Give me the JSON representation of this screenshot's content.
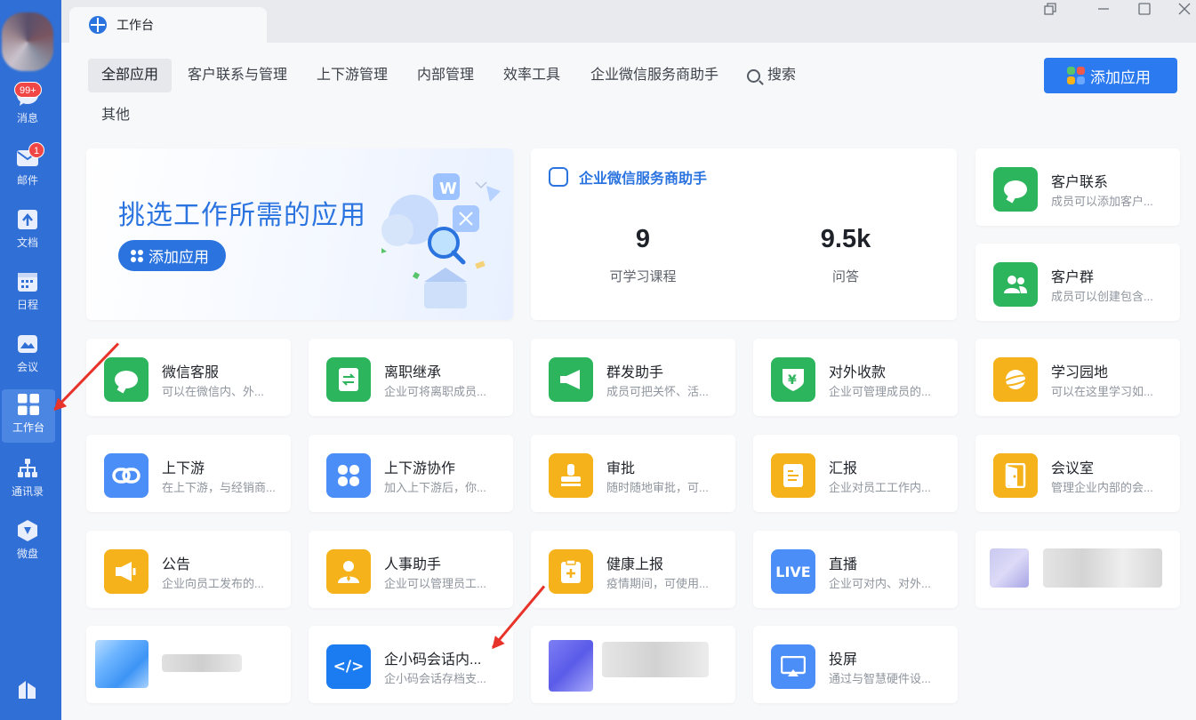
{
  "sidebar": {
    "items": [
      {
        "label": "消息",
        "badge": "99+"
      },
      {
        "label": "邮件",
        "badge": "1"
      },
      {
        "label": "文档"
      },
      {
        "label": "日程"
      },
      {
        "label": "会议"
      },
      {
        "label": "工作台"
      },
      {
        "label": "通讯录"
      },
      {
        "label": "微盘"
      }
    ]
  },
  "window": {
    "tab_title": "工作台"
  },
  "filters": [
    "全部应用",
    "客户联系与管理",
    "上下游管理",
    "内部管理",
    "效率工具",
    "企业微信服务商助手",
    "搜索",
    "其他"
  ],
  "add_app_button": "添加应用",
  "banner": {
    "title": "挑选工作所需的应用",
    "button": "添加应用"
  },
  "helper": {
    "title": "企业微信服务商助手",
    "stats": [
      {
        "value": "9",
        "label": "可学习课程"
      },
      {
        "value": "9.5k",
        "label": "问答"
      }
    ]
  },
  "apps": [
    {
      "title": "客户联系",
      "desc": "成员可以添加客户...",
      "color": "#2db55d",
      "icon": "wechat-bubble-icon"
    },
    {
      "title": "客户群",
      "desc": "成员可以创建包含...",
      "color": "#2db55d",
      "icon": "group-icon"
    },
    {
      "title": "微信客服",
      "desc": "可以在微信内、外...",
      "color": "#2db55d",
      "icon": "chat-bubble-icon"
    },
    {
      "title": "离职继承",
      "desc": "企业可将离职成员...",
      "color": "#2db55d",
      "icon": "transfer-doc-icon"
    },
    {
      "title": "群发助手",
      "desc": "成员可把关怀、活...",
      "color": "#2db55d",
      "icon": "megaphone-icon"
    },
    {
      "title": "对外收款",
      "desc": "企业可管理成员的...",
      "color": "#2db55d",
      "icon": "yuan-shield-icon"
    },
    {
      "title": "学习园地",
      "desc": "可以在这里学习如...",
      "color": "#f5b21b",
      "icon": "planet-icon"
    },
    {
      "title": "上下游",
      "desc": "在上下游，与经销商...",
      "color": "#4c8ef7",
      "icon": "link-icon"
    },
    {
      "title": "上下游协作",
      "desc": "加入上下游后，你...",
      "color": "#4c8ef7",
      "icon": "clover-icon"
    },
    {
      "title": "审批",
      "desc": "随时随地审批，可...",
      "color": "#f5b21b",
      "icon": "stamp-icon"
    },
    {
      "title": "汇报",
      "desc": "企业对员工工作内...",
      "color": "#f5b21b",
      "icon": "report-icon"
    },
    {
      "title": "会议室",
      "desc": "管理企业内部的会...",
      "color": "#f5b21b",
      "icon": "door-icon"
    },
    {
      "title": "公告",
      "desc": "企业向员工发布的...",
      "color": "#f5b21b",
      "icon": "announce-icon"
    },
    {
      "title": "人事助手",
      "desc": "企业可以管理员工...",
      "color": "#f5b21b",
      "icon": "person-icon"
    },
    {
      "title": "健康上报",
      "desc": "疫情期间，可使用...",
      "color": "#f5b21b",
      "icon": "clipboard-plus-icon"
    },
    {
      "title": "直播",
      "desc": "企业可对内、对外...",
      "color": "#4c8ef7",
      "icon": "live-icon",
      "glyph": "LIVE"
    },
    {
      "title": "企小码会话内...",
      "desc": "企小码会话存档支...",
      "color": "#1a7cf0",
      "icon": "code-icon",
      "glyph": "</>"
    },
    {
      "title": "投屏",
      "desc": "通过与智慧硬件设...",
      "color": "#4c8ef7",
      "icon": "screencast-icon"
    }
  ]
}
